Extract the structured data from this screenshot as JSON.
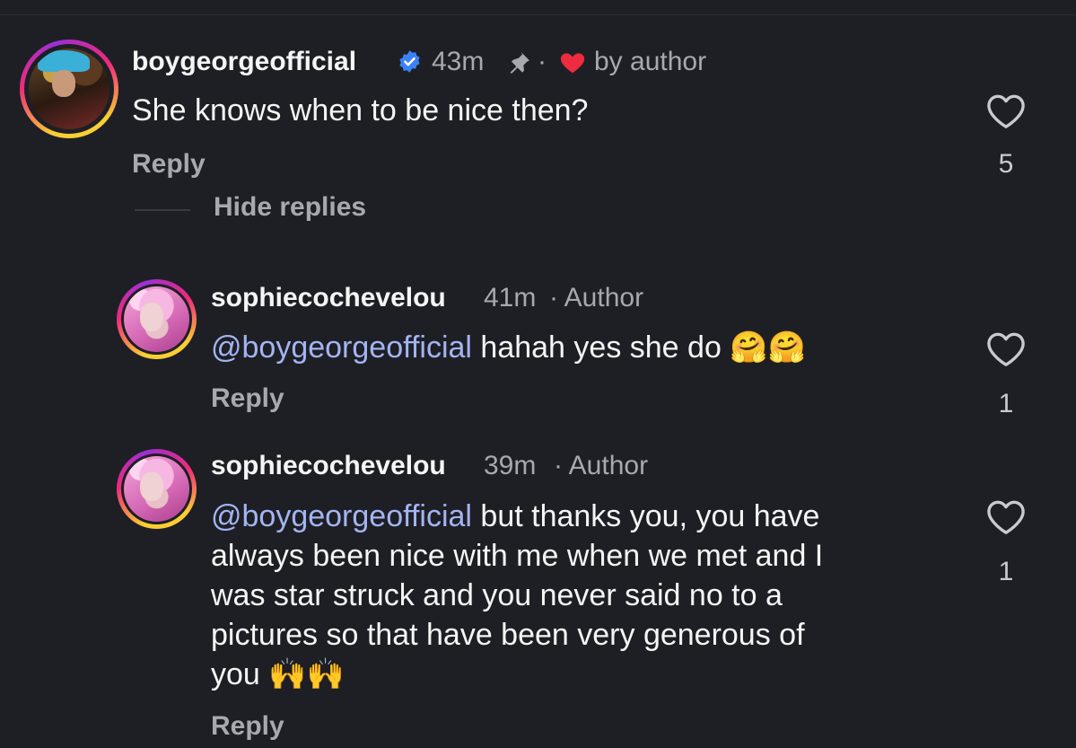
{
  "comments": [
    {
      "username": "boygeorgeofficial",
      "time": "43m",
      "separator": "·",
      "liked_by": "by author",
      "text": "She knows when to be nice then?",
      "reply_label": "Reply",
      "likes": "5"
    },
    {
      "username": "sophiecochevelou",
      "time": "41m",
      "badge": "· Author",
      "mention": "@boygeorgeofficial",
      "text": "hahah yes she do",
      "emoji": "🤗🤗",
      "reply_label": "Reply",
      "likes": "1"
    },
    {
      "username": "sophiecochevelou",
      "time": "39m",
      "badge": "· Author",
      "mention": "@boygeorgeofficial",
      "text_line1": "but thanks you, you have",
      "text_line2": "always been nice with me when we met and I",
      "text_line3": "was star struck and you never said no to a",
      "text_line4": "pictures so that have been very generous of",
      "text_line5": "you",
      "emoji": "🙌🙌",
      "reply_label": "Reply",
      "likes": "1"
    }
  ],
  "thread": {
    "hide_replies": "Hide replies"
  },
  "icons": {
    "verified": "verified-badge-icon",
    "pin": "pin-icon",
    "heart_filled": "heart-filled-icon",
    "like": "heart-outline-icon"
  },
  "colors": {
    "background": "#1e1f24",
    "mention": "#a3b4f2",
    "verified": "#3b82f6",
    "heart": "#ed2c3f"
  }
}
